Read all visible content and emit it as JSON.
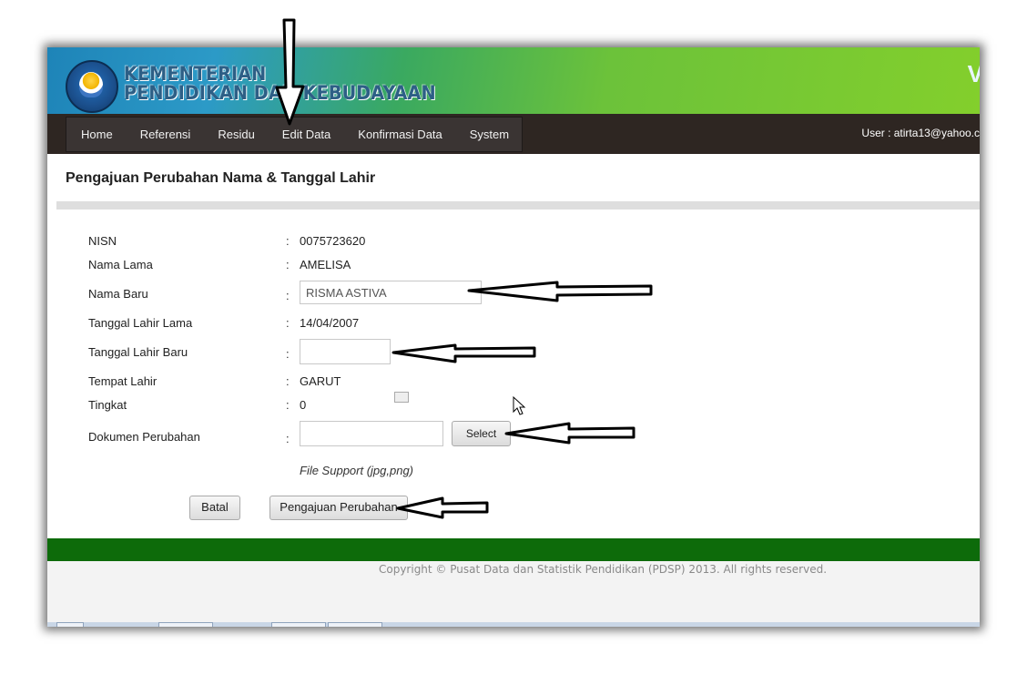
{
  "header": {
    "logo_alt": "kemdikbud-logo",
    "title_line1": "KEMENTERIAN",
    "title_line2": "PENDIDIKAN DAN KEBUDAYAAN",
    "right_text": "V"
  },
  "nav": {
    "items": [
      "Home",
      "Referensi",
      "Residu",
      "Edit Data",
      "Konfirmasi Data",
      "System"
    ],
    "user": "User : atirta13@yahoo.c"
  },
  "page": {
    "title": "Pengajuan Perubahan Nama & Tanggal Lahir"
  },
  "form": {
    "colon": ":",
    "nisn_label": "NISN",
    "nisn_value": "0075723620",
    "nama_lama_label": "Nama Lama",
    "nama_lama_value": "AMELISA",
    "nama_baru_label": "Nama Baru",
    "nama_baru_value": "RISMA ASTIVA",
    "tgl_lama_label": "Tanggal Lahir Lama",
    "tgl_lama_value": "14/04/2007",
    "tgl_baru_label": "Tanggal Lahir Baru",
    "tgl_baru_value": "",
    "tempat_label": "Tempat Lahir",
    "tempat_value": "GARUT",
    "tingkat_label": "Tingkat",
    "tingkat_value": "0",
    "dokumen_label": "Dokumen Perubahan",
    "dokumen_value": "",
    "select_button": "Select",
    "file_hint": "File Support (jpg,png)",
    "batal_button": "Batal",
    "submit_button": "Pengajuan Perubahan"
  },
  "footer": {
    "copyright": "Copyright © Pusat Data dan Statistik Pendidikan (PDSP) 2013. All rights reserved."
  },
  "colors": {
    "navbar": "#2e2622",
    "footer_band": "#0d6b0a",
    "header_green": "#6cc23a"
  }
}
